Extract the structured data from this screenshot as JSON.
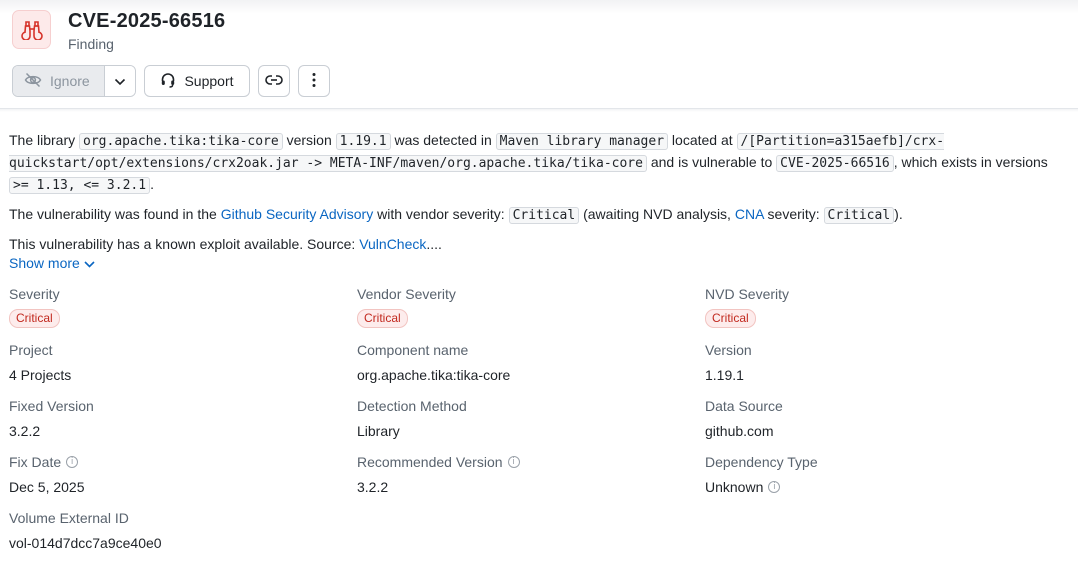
{
  "header": {
    "title": "CVE-2025-66516",
    "subtitle": "Finding"
  },
  "toolbar": {
    "ignore_label": "Ignore",
    "support_label": "Support"
  },
  "description": {
    "p1": {
      "t1": "The library ",
      "c1": "org.apache.tika:tika-core",
      "t2": " version ",
      "c2": "1.19.1",
      "t3": " was detected in ",
      "c3": "Maven library manager",
      "t4": " located at ",
      "c4": "/[Partition=a315aefb]/crx-quickstart/opt/extensions/crx2oak.jar -> META-INF/maven/org.apache.tika/tika-core",
      "t5": " and is vulnerable to ",
      "c5": "CVE-2025-66516",
      "t6": ", which exists in versions ",
      "c6": ">= 1.13, <= 3.2.1",
      "t7": "."
    },
    "p2": {
      "t1": "The vulnerability was found in the ",
      "l1": "Github Security Advisory",
      "t2": " with vendor severity: ",
      "c1": "Critical",
      "t3": " (awaiting NVD analysis, ",
      "l2": "CNA",
      "t4": " severity: ",
      "c2": "Critical",
      "t5": ")."
    },
    "p3": {
      "t1": "This vulnerability has a known exploit available. Source: ",
      "l1": "VulnCheck",
      "t2": "...."
    },
    "show_more": "Show more"
  },
  "fields": {
    "severity": {
      "label": "Severity",
      "value": "Critical"
    },
    "vendor_severity": {
      "label": "Vendor Severity",
      "value": "Critical"
    },
    "nvd_severity": {
      "label": "NVD Severity",
      "value": "Critical"
    },
    "project": {
      "label": "Project",
      "value": "4 Projects"
    },
    "component_name": {
      "label": "Component name",
      "value": "org.apache.tika:tika-core"
    },
    "version": {
      "label": "Version",
      "value": "1.19.1"
    },
    "fixed_version": {
      "label": "Fixed Version",
      "value": "3.2.2"
    },
    "detection_method": {
      "label": "Detection Method",
      "value": "Library"
    },
    "data_source": {
      "label": "Data Source",
      "value": "github.com"
    },
    "fix_date": {
      "label": "Fix Date",
      "value": "Dec 5, 2025"
    },
    "recommended_version": {
      "label": "Recommended Version",
      "value": "3.2.2"
    },
    "dependency_type": {
      "label": "Dependency Type",
      "value": "Unknown"
    },
    "volume_external_id": {
      "label": "Volume External ID",
      "value": "vol-014d7dcc7a9ce40e0"
    }
  },
  "icons": {
    "logo": "binoculars-icon",
    "ignore": "eye-off-icon",
    "caret": "chevron-down-icon",
    "support": "headset-icon",
    "link": "link-icon",
    "more": "kebab-menu-icon",
    "info": "info-icon"
  },
  "colors": {
    "accent_link": "#0a66c2",
    "critical": "#c2291f",
    "critical_bg": "#fdecec"
  }
}
